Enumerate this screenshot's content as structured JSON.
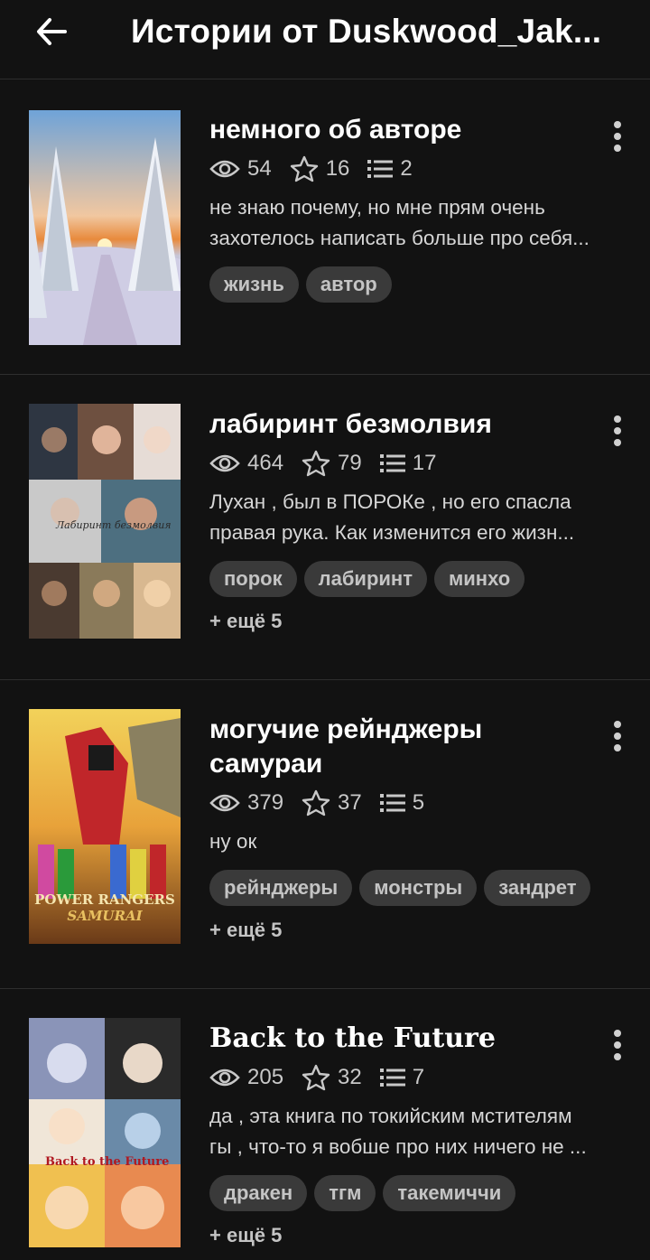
{
  "header": {
    "title": "Истории от Duskwood_Jak..."
  },
  "stories": [
    {
      "title": "немного об авторе",
      "views": "54",
      "votes": "16",
      "parts": "2",
      "desc_line1": "не знаю почему, но мне прям очень",
      "desc_line2": "захотелось написать больше про себя...",
      "tags": [
        "жизнь",
        "автор"
      ],
      "more": ""
    },
    {
      "title": "лабиринт безмолвия",
      "views": "464",
      "votes": "79",
      "parts": "17",
      "desc_line1": "Лухан , был в ПОРОКе , но его спасла",
      "desc_line2": "правая рука. Как изменится его жизн...",
      "tags": [
        "порок",
        "лабиринт",
        "минхо"
      ],
      "more": "+ ещё 5",
      "cover_text": "Лабиринт безмолвия"
    },
    {
      "title_line1": "могучие рейнджеры",
      "title_line2": "самураи",
      "views": "379",
      "votes": "37",
      "parts": "5",
      "desc_line1": "ну ок",
      "tags": [
        "рейнджеры",
        "монстры",
        "зандрет"
      ],
      "more": "+ ещё 5",
      "cover_text1": "POWER RANGERS",
      "cover_text2": "SAMURAI"
    },
    {
      "title": "Back to the Future",
      "views": "205",
      "votes": "32",
      "parts": "7",
      "desc_line1": "да , эта книга по токийским мстителям",
      "desc_line2": "гы , что-то я вобше про них ничего не ...",
      "tags": [
        "дракен",
        "тгм",
        "такемиччи"
      ],
      "more": "+ ещё 5",
      "cover_text": "Back to the Future"
    }
  ],
  "icons": {
    "back": "arrow-left-icon",
    "views": "eye-icon",
    "votes": "star-icon",
    "parts": "list-icon",
    "menu": "more-vertical-icon"
  },
  "colors": {
    "background": "#121212",
    "tag_bg": "#3a3a3a",
    "divider": "#2e2e2e"
  }
}
